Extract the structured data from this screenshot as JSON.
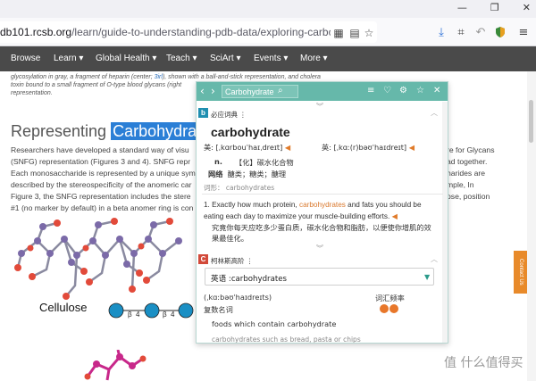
{
  "window": {
    "minimize": "—",
    "maximize": "❐",
    "close": "✕"
  },
  "urlbar": {
    "host": "db101.rcsb.org",
    "path": "/learn/guide-to-understanding-pdb-data/exploring-carbohydrates-in-the"
  },
  "site_nav": {
    "items": [
      {
        "label": "Browse"
      },
      {
        "label": "Learn ▾"
      },
      {
        "label": "Global Health ▾"
      },
      {
        "label": "Teach ▾"
      },
      {
        "label": "SciArt ▾"
      },
      {
        "label": "Events ▾"
      },
      {
        "label": "More ▾"
      }
    ]
  },
  "page": {
    "caption_line1_a": "glycosylation in gray, a fragment of heparin (center; ",
    "caption_link": "3irl",
    "caption_line1_b": "), shown with a ball-and-stick representation, and cholera",
    "caption_line2": "toxin bound to a small fragment of O-type blood glycans (right",
    "caption_line3": "representation.",
    "heading_prefix": "Representing ",
    "heading_highlight": "Carbohydrates",
    "para_lines": [
      "Researchers have developed a standard way of visu",
      "(SNFG) representation (Figures 3 and 4). SNFG repr",
      "Each monosaccharide is represented by a unique sym",
      "described by the stereospecificity of the anomeric car",
      "Figure 3, the SNFG representation includes the stere",
      "#1 (no marker by default) in a beta anomer ring is con"
    ],
    "para_right_lines": [
      "re for Glycans",
      "ad together.",
      "harides are",
      "mple, In",
      "ose, position"
    ],
    "side_tab": "Contact Us",
    "cellulose_label": "Cellulose",
    "beta_labels": [
      "β",
      "4",
      "β",
      "4"
    ],
    "watermark": "值 什么值得买"
  },
  "popup": {
    "search_value": "Carbohydrate",
    "bing_dict_name": "必应词典",
    "bing_dict_menu": "⋮",
    "word": "carbohydrate",
    "phon_us": "美: [ˌkɑrbouˈhaɪˌdreɪt]",
    "phon_uk": "英: [ˌkɑː(r)bəʊˈhaɪdreɪt]",
    "pos": "n.",
    "def_tag": "【化】碳水化合物",
    "web_label": "网络",
    "web_def": "醣类；糖类；醣理",
    "forms_label": "词形：",
    "forms_value": "carbohydrates",
    "example_num": "1.",
    "example_a": "Exactly how much protein, ",
    "example_kw": "carbohydrates",
    "example_b": " and fats you should be eating each day to maximize your muscle-building efforts.",
    "example_cn": "究竟你每天应吃多少蛋白质，碳水化合物和脂肪，以便使你增肌的效果最佳化。",
    "collins_name": "柯林斯高阶",
    "collins_menu": "⋮",
    "dropdown_value": "英语 :carbohydrates",
    "collins_phon": "(ˌkɑːbəʊˈhaɪdreɪts)",
    "collins_pos": "复数名词",
    "freq_label": "词汇频率",
    "collins_def": "foods which contain carbohydrate",
    "collins_ex": "carbohydrates such as bread, pasta or chips",
    "freq_level": 2
  },
  "colors": {
    "nav_bg": "#4a4a4a",
    "highlight": "#2b7fd6",
    "popup_header": "#66b8aa",
    "bing_tag": "#1f8fb0",
    "collins_tag": "#d24a3a",
    "accent_orange": "#e8772a",
    "molecule_purple": "#7b6aa8",
    "molecule_red": "#e24a3a",
    "snfg_blue": "#1a8fc4",
    "heparin_magenta": "#c8288a"
  }
}
